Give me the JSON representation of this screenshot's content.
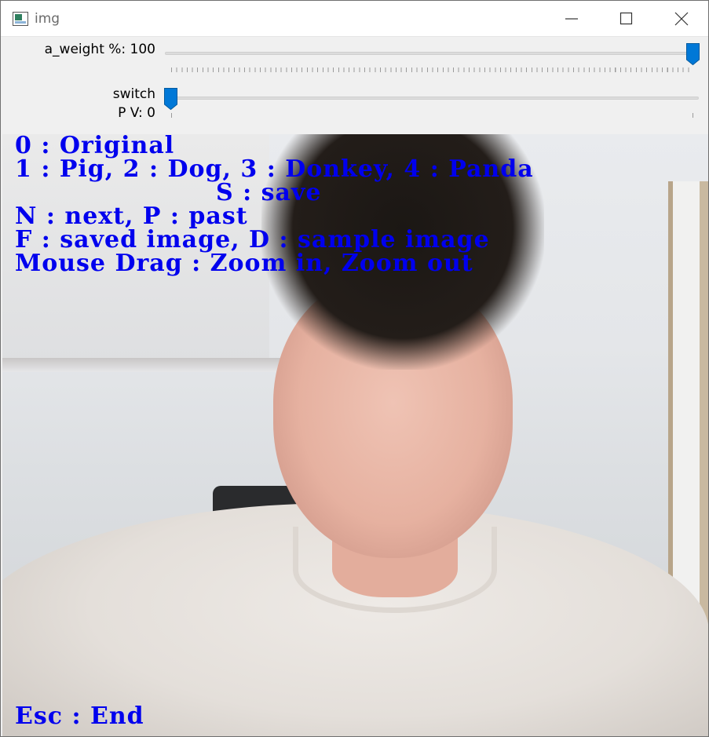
{
  "window": {
    "title": "img",
    "icon": "opencv-window-icon",
    "controls": [
      "minimize-icon",
      "maximize-icon",
      "close-icon"
    ]
  },
  "trackbars": [
    {
      "label": "a_weight %: 100",
      "value": 100,
      "min": 0,
      "max": 100
    },
    {
      "label": "switch",
      "sub_label": "P V: 0",
      "value": 0,
      "min": 0,
      "max": 1
    }
  ],
  "overlay": {
    "color": "#0000ee",
    "lines": [
      "0 : Original",
      "1 : Pig, 2 : Dog, 3 : Donkey, 4 : Panda",
      "S : save",
      "N : next, P : past",
      "F : saved image, D : sample image",
      "Mouse Drag : Zoom in, Zoom out"
    ],
    "footer": "Esc : End"
  },
  "accent_color": "#0078d7"
}
